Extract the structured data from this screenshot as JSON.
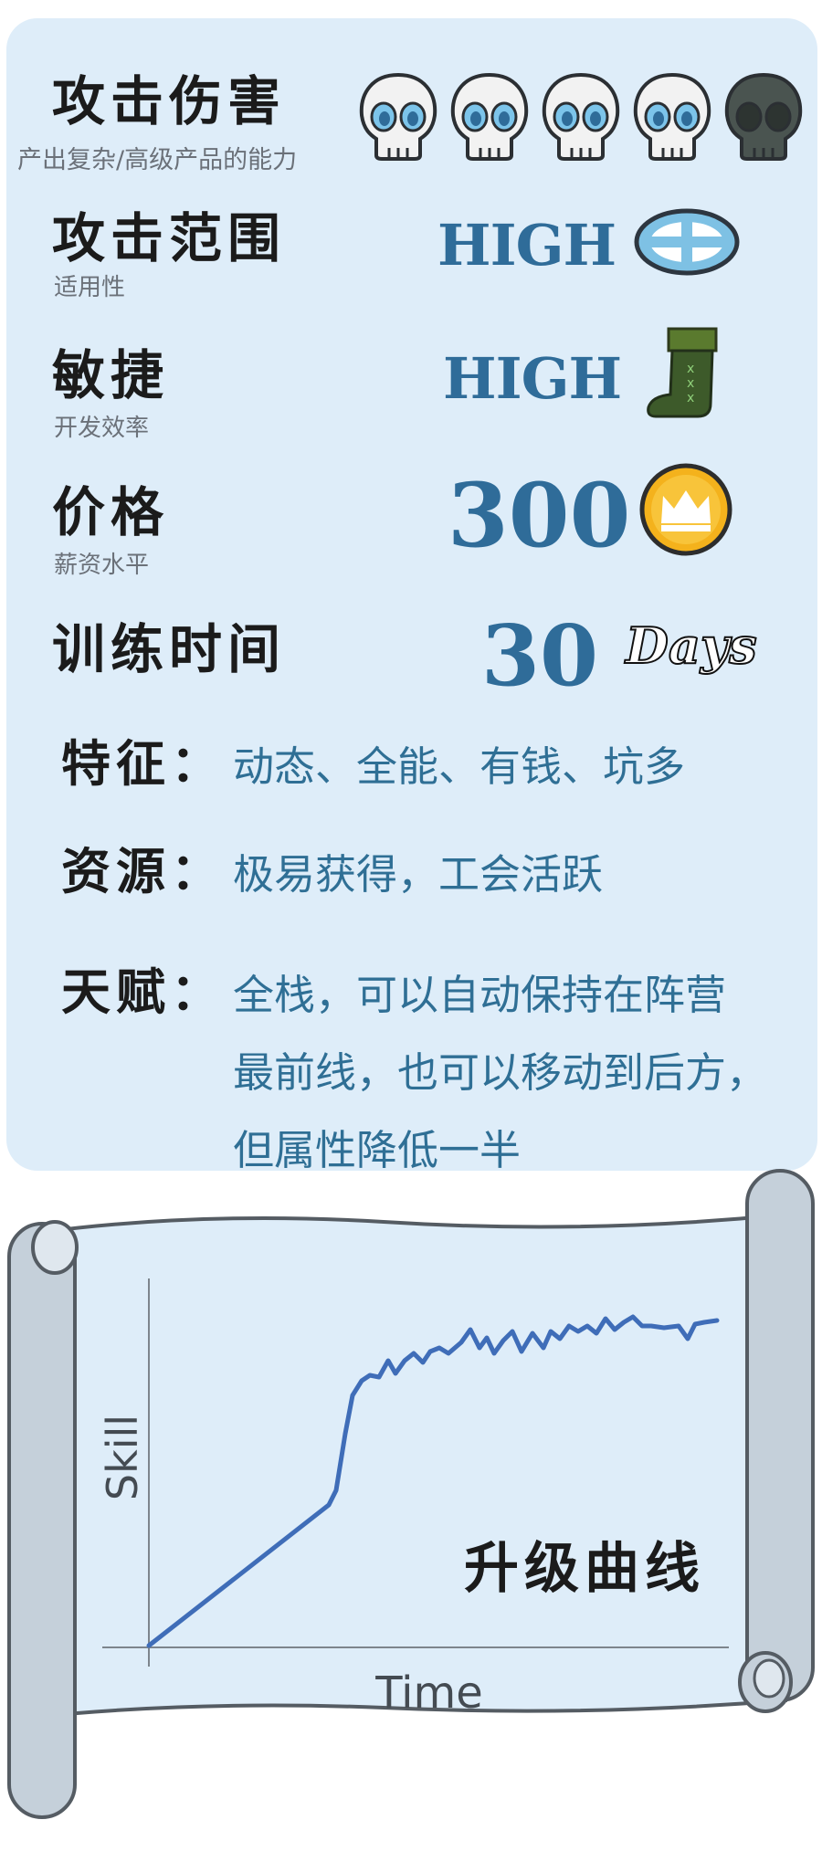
{
  "stats": {
    "attack_damage": {
      "label": "攻击伤害",
      "sub": "产出复杂/高级产品的能力",
      "rating": 4,
      "max": 5,
      "icon": "skull-icon"
    },
    "attack_range": {
      "label": "攻击范围",
      "sub": "适用性",
      "value": "HIGH",
      "icon": "crosshair-disc-icon"
    },
    "agility": {
      "label": "敏捷",
      "sub": "开发效率",
      "value": "HIGH",
      "icon": "boot-icon"
    },
    "price": {
      "label": "价格",
      "sub": "薪资水平",
      "value": "300",
      "icon": "crown-coin-icon"
    },
    "training": {
      "label": "训练时间",
      "value": "30",
      "unit": "Days"
    }
  },
  "traits": {
    "features_label": "特征：",
    "features_value": "动态、全能、有钱、坑多",
    "resources_label": "资源：",
    "resources_value": "极易获得，工会活跃",
    "talent_label": "天赋：",
    "talent_line1": "全栈，可以自动保持在阵营",
    "talent_line2": "最前线，也可以移动到后方，",
    "talent_line3": "但属性降低一半"
  },
  "scroll": {
    "title": "升级曲线",
    "xlabel": "Time",
    "ylabel": "Skill"
  },
  "colors": {
    "card_bg": "#deedf9",
    "value_blue": "#2f6c99",
    "text_blue": "#2f6f95",
    "curve": "#3f6db8",
    "scroll_rod": "#c5d0da"
  }
}
